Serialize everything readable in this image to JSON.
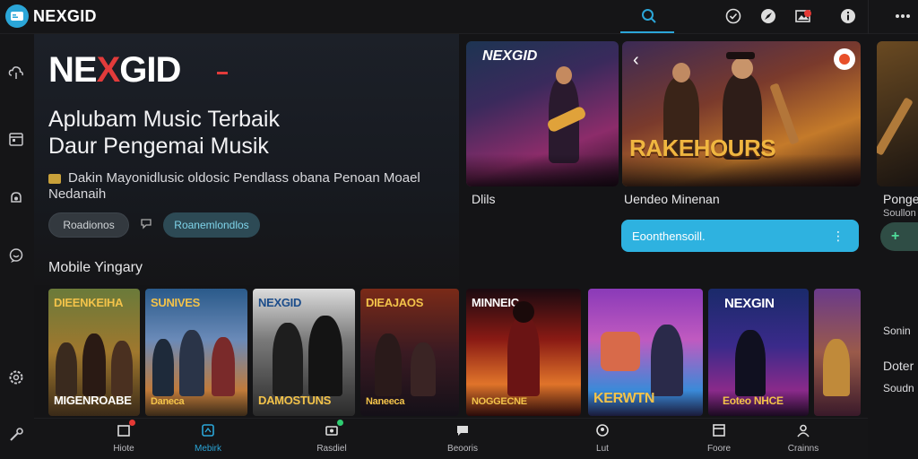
{
  "app": {
    "name": "NEXGID"
  },
  "topbar": {
    "icons": [
      "search-icon",
      "check-circle-icon",
      "compass-icon",
      "image-icon",
      "info-icon",
      "more-icon"
    ]
  },
  "hero": {
    "logo_text_a": "NE",
    "logo_text_x": "X",
    "logo_text_b": "GID",
    "title_line1": "Aplubam Music Terbaik",
    "title_line2": "Daur Pengemai Musik",
    "description": "Dakin Mayonidlusic oldosic Pendlass obana Penoan Moael Nedanaih",
    "button_primary": "Roadionos",
    "button_secondary": "Roanemlondlos",
    "section_title": "Mobile Yingary"
  },
  "featured": [
    {
      "logo": "NEXGID",
      "caption": "Dlils"
    },
    {
      "banner": "RAKEHOURS",
      "caption": "Uendeo Minenan"
    },
    {
      "caption": "Ponge",
      "subcaption": "Soullon"
    }
  ],
  "cta": {
    "label": "Eoonthensoill.",
    "side_symbol": "+"
  },
  "posters": [
    {
      "title": "DIEENKEIHA",
      "bottom": "MIGENROABE"
    },
    {
      "title": "SUNIVES",
      "bottom": "Daneca"
    },
    {
      "title": "NEXGID",
      "bottom": "DAMOSTUNS"
    },
    {
      "title": "DIEAJAOS",
      "bottom": "Naneeca"
    },
    {
      "title": "MINNEIC",
      "bottom": "NOGGECNE"
    },
    {
      "title": "",
      "bottom": "KERWTN"
    },
    {
      "title": "NEXGIN",
      "bottom": "Eoteo NHCE"
    }
  ],
  "right_list": [
    {
      "label": "Sonin"
    },
    {
      "label": "Doter"
    },
    {
      "label": "Soudn"
    }
  ],
  "bottom_nav": [
    {
      "label": "Hiote",
      "icon": "home-icon",
      "active": false,
      "dot": "#e53935"
    },
    {
      "label": "Mebirk",
      "icon": "library-icon",
      "active": true,
      "dot": ""
    },
    {
      "label": "Rasdiel",
      "icon": "radio-icon",
      "active": false,
      "dot": "#2ecc71"
    },
    {
      "label": "Beooris",
      "icon": "chat-icon",
      "active": false,
      "dot": ""
    },
    {
      "label": "Lut",
      "icon": "user-icon",
      "active": false,
      "dot": ""
    },
    {
      "label": "Foore",
      "icon": "window-icon",
      "active": false,
      "dot": ""
    },
    {
      "label": "Crainns",
      "icon": "profile-icon",
      "active": false,
      "dot": ""
    }
  ],
  "colors": {
    "accent": "#2ba6d8",
    "brand_red": "#e23b3b",
    "background": "#141416"
  }
}
